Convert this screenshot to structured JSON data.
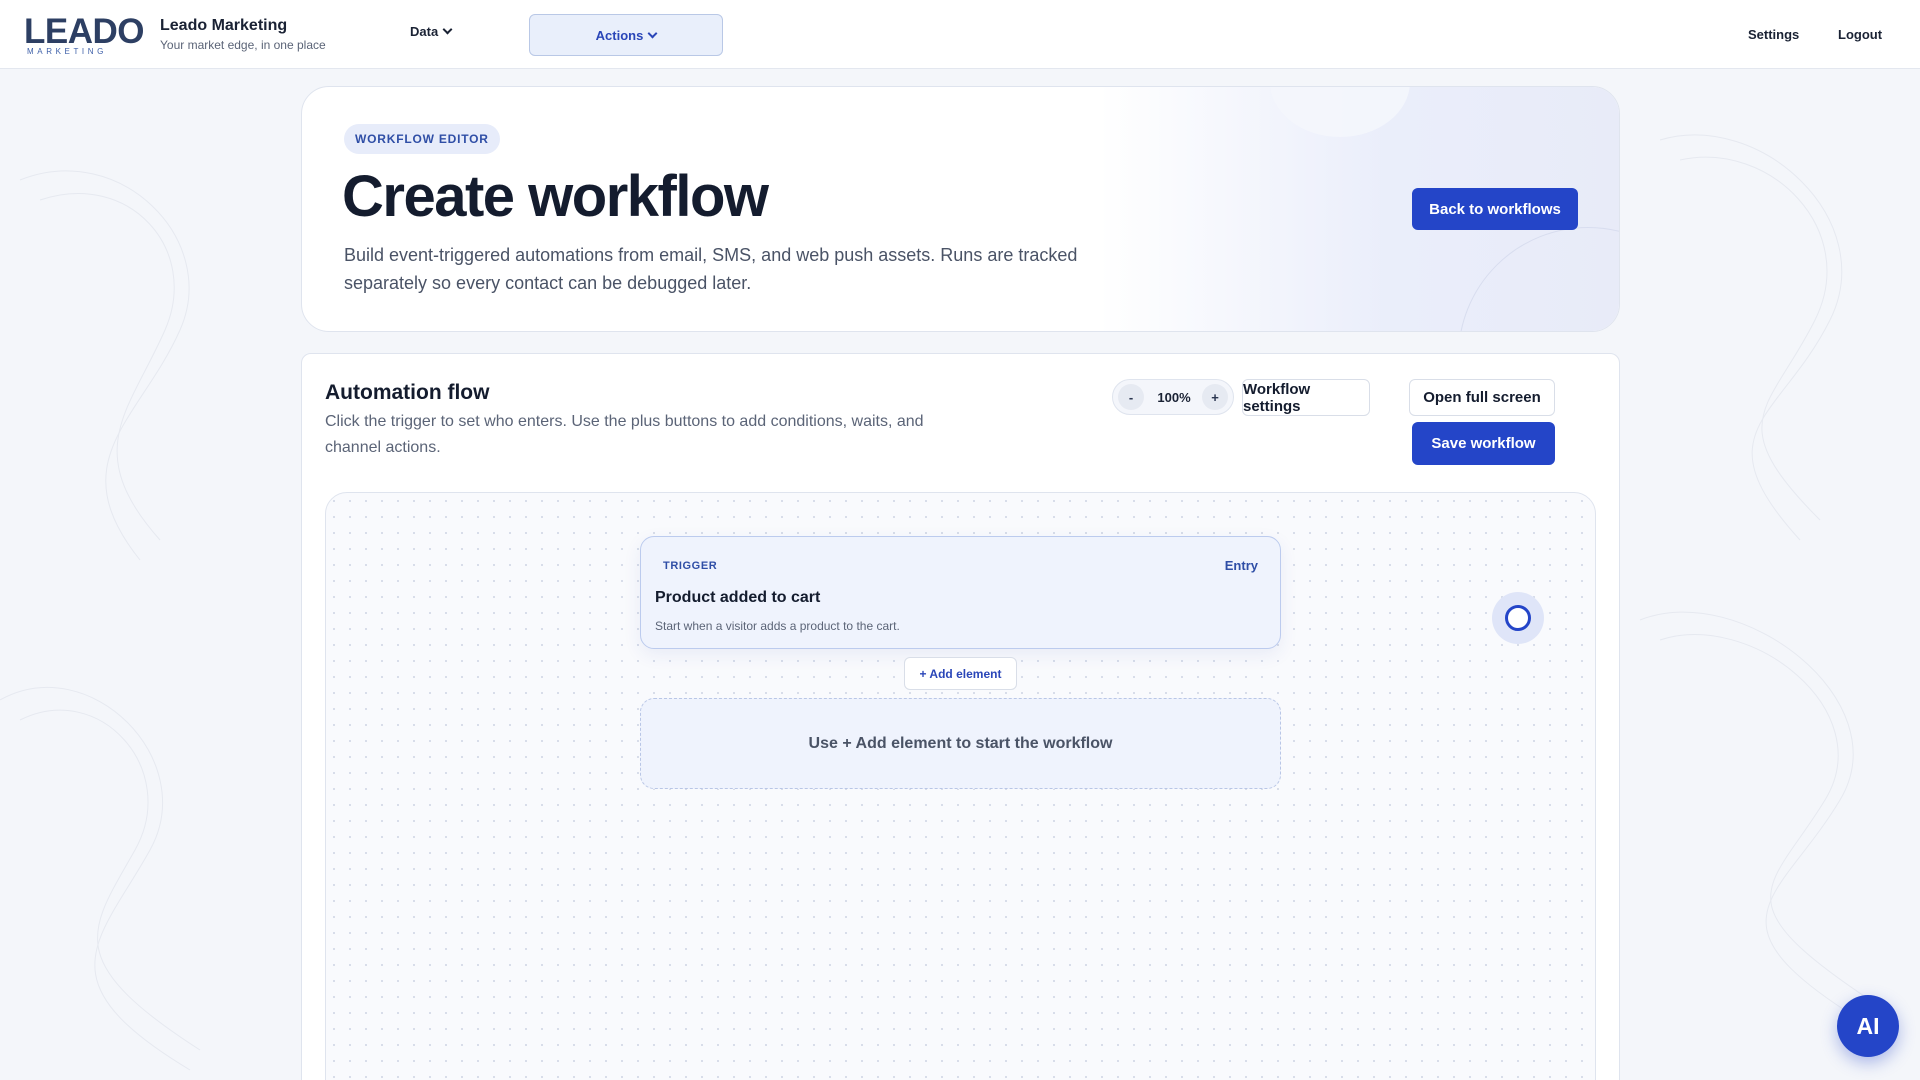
{
  "brand": {
    "logo_text": "LEADO",
    "logo_subtext": "MARKETING",
    "name": "Leado Marketing",
    "tagline": "Your market edge, in one place"
  },
  "nav": {
    "data_label": "Data",
    "actions_label": "Actions",
    "settings_label": "Settings",
    "logout_label": "Logout"
  },
  "hero": {
    "badge": "WORKFLOW EDITOR",
    "title": "Create workflow",
    "description": "Build event-triggered automations from email, SMS, and web push assets. Runs are tracked separately so every contact can be debugged later.",
    "back_button": "Back to workflows"
  },
  "automation": {
    "title": "Automation flow",
    "description": "Click the trigger to set who enters. Use the plus buttons to add conditions, waits, and channel actions.",
    "zoom": {
      "minus": "-",
      "value": "100%",
      "plus": "+"
    },
    "workflow_settings_button": "Workflow settings",
    "full_screen_button": "Open full screen",
    "save_button": "Save workflow"
  },
  "canvas": {
    "trigger": {
      "label": "TRIGGER",
      "entry": "Entry",
      "title": "Product added to cart",
      "description": "Start when a visitor adds a product to the cart."
    },
    "add_element_button": "+ Add element",
    "placeholder": "Use + Add element to start the workflow"
  },
  "ai_button": "AI",
  "colors": {
    "primary": "#2445c8",
    "background": "#f4f6fa",
    "card": "#ffffff",
    "trigger_bg": "#eff3fd"
  },
  "icons": {
    "chevron": "chevron-down-icon",
    "spinner": "loading-spinner-icon"
  }
}
